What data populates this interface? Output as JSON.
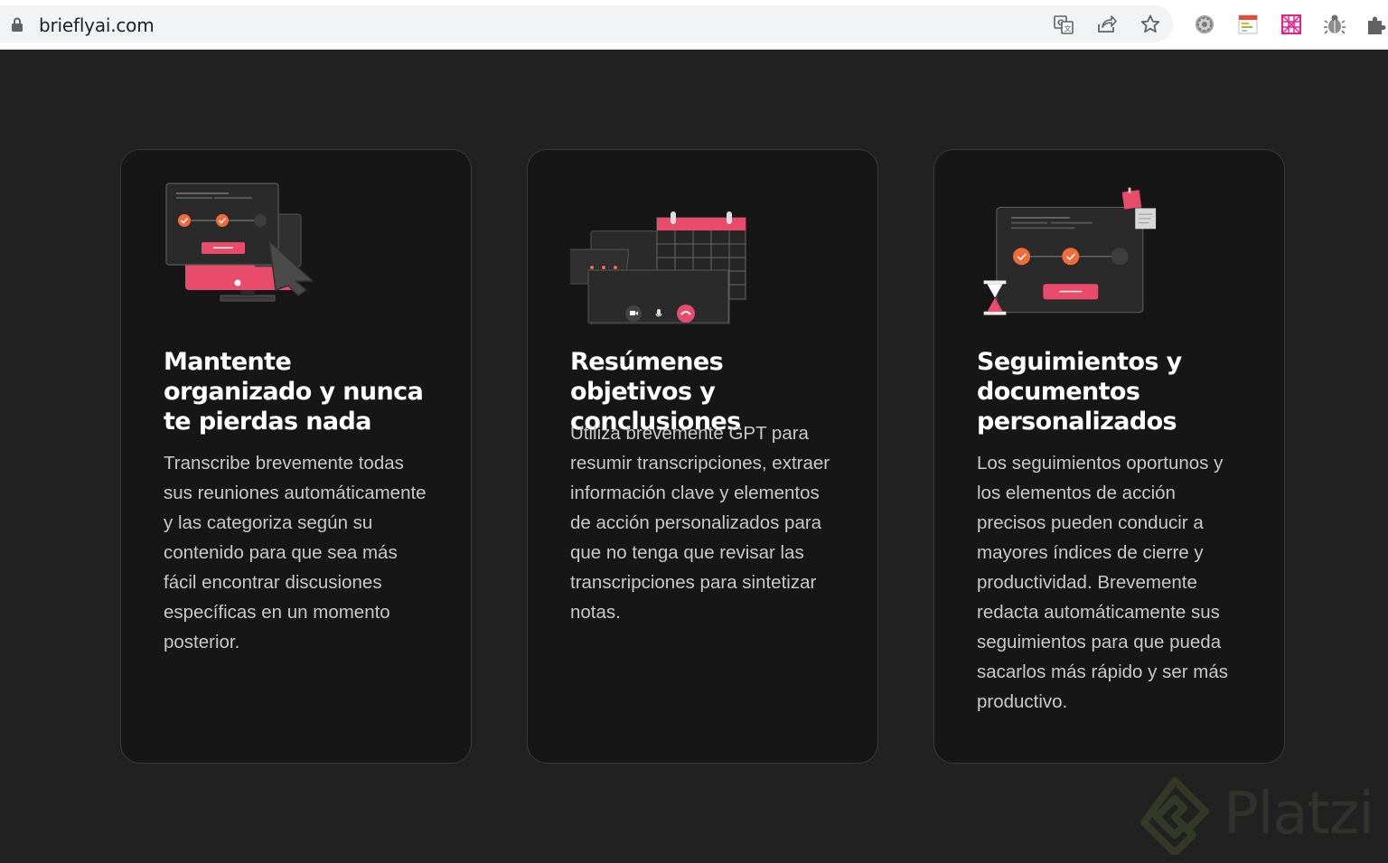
{
  "browser": {
    "url": "brieflyai.com",
    "icons": [
      "lock-icon",
      "translate-icon",
      "share-icon",
      "bookmark-star-icon",
      "settings-extension-icon",
      "notes-extension-icon",
      "grid-extension-icon",
      "bug-extension-icon",
      "puzzle-extensions-icon"
    ]
  },
  "cards": [
    {
      "title": "Mantente organizado y nunca te pierdas nada",
      "body": "Transcribe brevemente todas sus reuniones automáticamente y las categoriza según su contenido para que sea más fácil encontrar discusiones específicas en un momento posterior.",
      "illustration": "monitor-workflow-illustration"
    },
    {
      "title": "Resúmenes objetivos y conclusiones",
      "body": "Utiliza brevemente GPT para resumir transcripciones, extraer información clave y elementos de acción personalizados para que no tenga que revisar las transcripciones para sintetizar notas.",
      "illustration": "video-call-calendar-illustration"
    },
    {
      "title": "Seguimientos y documentos personalizados",
      "body": "Los seguimientos oportunos y los elementos de acción precisos pueden conducir a mayores índices de cierre y productividad. Brevemente redacta automáticamente sus seguimientos para que pueda sacarlos más rápido y ser más productivo.",
      "illustration": "followup-documents-illustration"
    }
  ],
  "watermark": {
    "text": "Platzi"
  },
  "colors": {
    "accent": "#e94b6a",
    "orange": "#f26b3a",
    "background": "#212121",
    "card": "#161616"
  }
}
